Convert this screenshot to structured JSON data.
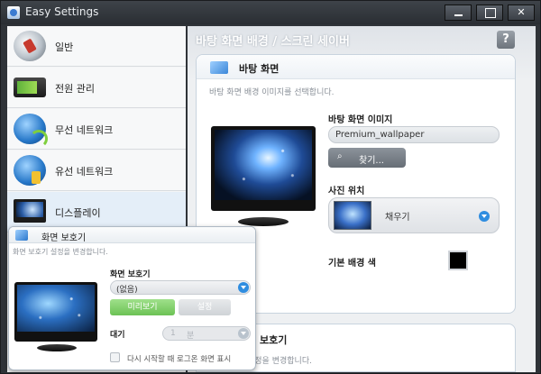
{
  "window": {
    "title": "Easy Settings"
  },
  "sidebar": {
    "items": [
      {
        "label": "일반",
        "icon": "general-settings-icon"
      },
      {
        "label": "전원 관리",
        "icon": "battery-icon"
      },
      {
        "label": "무선 네트워크",
        "icon": "wireless-globe-icon"
      },
      {
        "label": "유선 네트워크",
        "icon": "wired-globe-icon"
      },
      {
        "label": "디스플레이",
        "icon": "display-icon"
      }
    ]
  },
  "content": {
    "breadcrumb": "바탕 화면 배경 / 스크린 세이버",
    "help_label": "?",
    "wallpaper": {
      "title": "바탕 화면",
      "description": "바탕 화면 배경 이미지를 선택합니다.",
      "image_label": "바탕 화면 이미지",
      "image_value": "Premium_wallpaper",
      "browse_label": "찾기...",
      "position_label": "사진 위치",
      "position_value": "채우기",
      "bgcolor_label": "기본 배경 색",
      "bgcolor_value": "#000000"
    },
    "screensaver_panel": {
      "title": "면 보호기",
      "description": "설정을 변경합니다."
    }
  },
  "popup": {
    "title": "화면 보호기",
    "description": "화면 보호기 설정을 변경합니다.",
    "screensaver_label": "화면 보호기",
    "screensaver_value": "(없음)",
    "preview_label": "미리보기",
    "settings_label": "설정",
    "wait_label": "대기",
    "wait_value": "1",
    "wait_unit": "분",
    "logon_label": "다시 시작할 때 로그온 화면 표시"
  }
}
